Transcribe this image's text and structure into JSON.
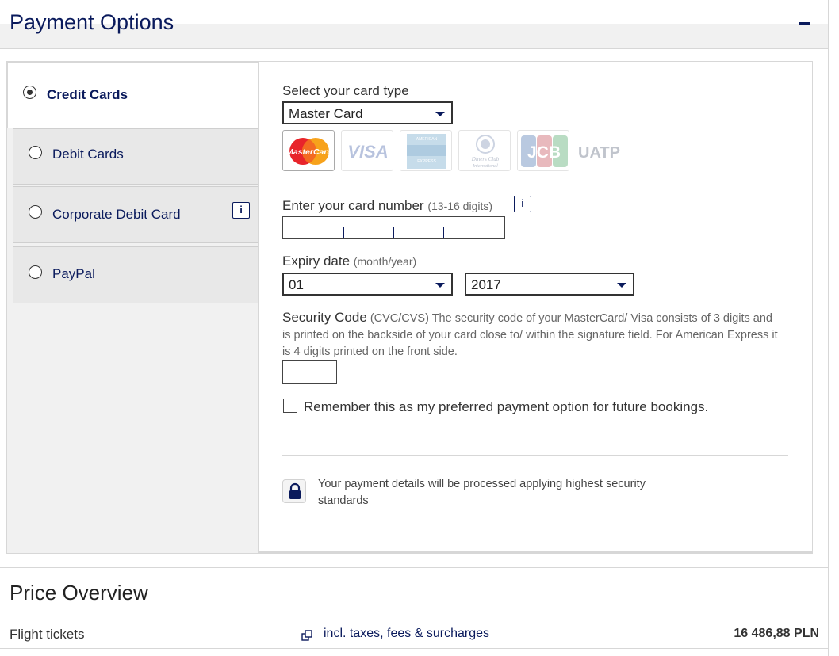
{
  "header": {
    "title": "Payment Options",
    "collapse_symbol": "−"
  },
  "tabs": [
    {
      "label": "Credit Cards",
      "selected": true
    },
    {
      "label": "Debit Cards",
      "selected": false
    },
    {
      "label": "Corporate Debit Card",
      "selected": false,
      "info": "i"
    },
    {
      "label": "PayPal",
      "selected": false
    }
  ],
  "card_type": {
    "label": "Select your card type",
    "selected": "Master Card",
    "logos": [
      {
        "name": "mastercard-logo",
        "text": "MasterCard",
        "selected": true
      },
      {
        "name": "visa-logo",
        "text": "VISA"
      },
      {
        "name": "american-express-logo",
        "text": "AMERICAN EXPRESS"
      },
      {
        "name": "diners-club-logo",
        "text": "Diners Club International"
      },
      {
        "name": "jcb-logo",
        "text": "JCB"
      },
      {
        "name": "uatp-logo",
        "text": "UATP"
      }
    ]
  },
  "card_number": {
    "label": "Enter your card number",
    "hint": "(13-16 digits)",
    "info": "i",
    "value": ""
  },
  "expiry": {
    "label": "Expiry date",
    "hint": "(month/year)",
    "month": "01",
    "year": "2017"
  },
  "security": {
    "label": "Security Code",
    "description": "(CVC/CVS) The security code of your MasterCard/ Visa consists of 3 digits and is printed on the backside of your card close to/ within the signature field. For American Express it is 4 digits printed on the front side.",
    "value": ""
  },
  "remember": {
    "label": "Remember this as my preferred payment option for future bookings.",
    "checked": false
  },
  "security_note": "Your payment details will be processed applying highest security standards",
  "price_overview": {
    "title": "Price Overview",
    "row_label": "Flight tickets",
    "link": "incl. taxes, fees & surcharges",
    "total": "16 486,88 PLN"
  },
  "colors": {
    "brand_navy": "#0a1a5c",
    "panel_gray": "#f1f1f1",
    "border_gray": "#d7d7d7"
  }
}
